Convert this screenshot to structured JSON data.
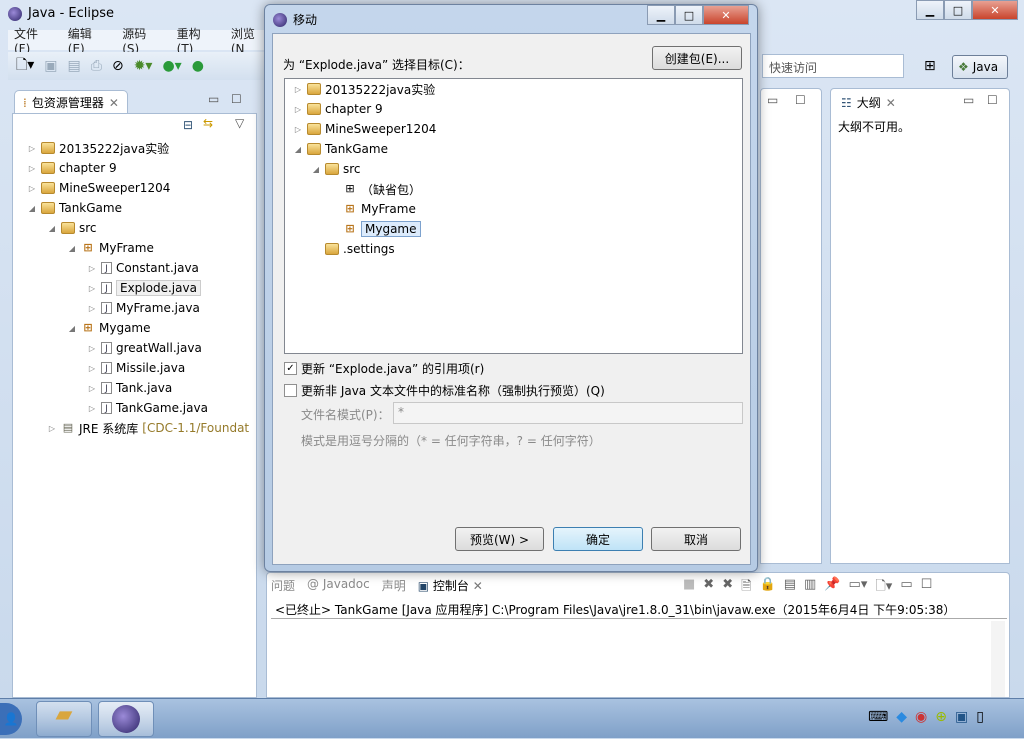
{
  "window": {
    "title": "Java  -  Eclipse"
  },
  "menu": [
    "文件(F)",
    "编辑(E)",
    "源码(S)",
    "重构(T)",
    "浏览(N"
  ],
  "quick_access": {
    "placeholder": "快速访问"
  },
  "perspective": {
    "label": "Java"
  },
  "package_explorer": {
    "tab": "包资源管理器",
    "items": [
      {
        "label": "20135222java实验",
        "depth": 0,
        "expanded": false,
        "icon": "project-icon"
      },
      {
        "label": "chapter 9",
        "depth": 0,
        "expanded": false,
        "icon": "project-icon"
      },
      {
        "label": "MineSweeper1204",
        "depth": 0,
        "expanded": false,
        "icon": "project-icon"
      },
      {
        "label": "TankGame",
        "depth": 0,
        "expanded": true,
        "icon": "project-icon"
      },
      {
        "label": "src",
        "depth": 1,
        "expanded": true,
        "icon": "source-folder-icon"
      },
      {
        "label": "MyFrame",
        "depth": 2,
        "expanded": true,
        "icon": "package-icon"
      },
      {
        "label": "Constant.java",
        "depth": 3,
        "expanded": false,
        "icon": "java-file-icon"
      },
      {
        "label": "Explode.java",
        "depth": 3,
        "expanded": false,
        "icon": "java-file-icon",
        "selected": true
      },
      {
        "label": "MyFrame.java",
        "depth": 3,
        "expanded": false,
        "icon": "java-file-icon"
      },
      {
        "label": "Mygame",
        "depth": 2,
        "expanded": true,
        "icon": "package-icon"
      },
      {
        "label": "greatWall.java",
        "depth": 3,
        "expanded": false,
        "icon": "java-file-icon"
      },
      {
        "label": "Missile.java",
        "depth": 3,
        "expanded": false,
        "icon": "java-file-icon"
      },
      {
        "label": "Tank.java",
        "depth": 3,
        "expanded": false,
        "icon": "java-file-icon"
      },
      {
        "label": "TankGame.java",
        "depth": 3,
        "expanded": false,
        "icon": "java-file-icon"
      }
    ],
    "jre": {
      "label": "JRE 系统库",
      "detail": "[CDC-1.1/Foundat"
    }
  },
  "outline": {
    "tab": "大纲",
    "message": "大纲不可用。"
  },
  "dialog": {
    "title": "移动",
    "prompt": "为 “Explode.java” 选择目标(C)：",
    "create_package": "创建包(E)...",
    "tree": [
      {
        "label": "20135222java实验",
        "depth": 0,
        "arrow": "▷",
        "icon": "project-icon"
      },
      {
        "label": "chapter 9",
        "depth": 0,
        "arrow": "▷",
        "icon": "project-icon"
      },
      {
        "label": "MineSweeper1204",
        "depth": 0,
        "arrow": "▷",
        "icon": "project-icon"
      },
      {
        "label": "TankGame",
        "depth": 0,
        "arrow": "◢",
        "icon": "project-icon"
      },
      {
        "label": "src",
        "depth": 1,
        "arrow": "◢",
        "icon": "source-folder-icon"
      },
      {
        "label": "（缺省包）",
        "depth": 2,
        "arrow": "",
        "icon": "default-package-icon"
      },
      {
        "label": "MyFrame",
        "depth": 2,
        "arrow": "",
        "icon": "package-icon"
      },
      {
        "label": "Mygame",
        "depth": 2,
        "arrow": "",
        "icon": "package-icon",
        "selected": true
      },
      {
        "label": ".settings",
        "depth": 1,
        "arrow": "",
        "icon": "folder-icon"
      }
    ],
    "update_refs": {
      "label": "更新 “Explode.java” 的引用项(r)",
      "checked": true
    },
    "update_nonjava": {
      "label": "更新非 Java 文本文件中的标准名称（强制执行预览）(Q)",
      "checked": false
    },
    "pattern_label": "文件名模式(P)：",
    "pattern_value": "*",
    "pattern_hint": "模式是用逗号分隔的（* = 任何字符串，? = 任何字符）",
    "preview": "预览(W) >",
    "ok": "确定",
    "cancel": "取消"
  },
  "console": {
    "tabs": [
      "问题",
      "@ Javadoc",
      "声明",
      "控制台"
    ],
    "status": "<已终止> TankGame [Java 应用程序] C:\\Program Files\\Java\\jre1.8.0_31\\bin\\javaw.exe（2015年6月4日 下午9:05:38）"
  }
}
